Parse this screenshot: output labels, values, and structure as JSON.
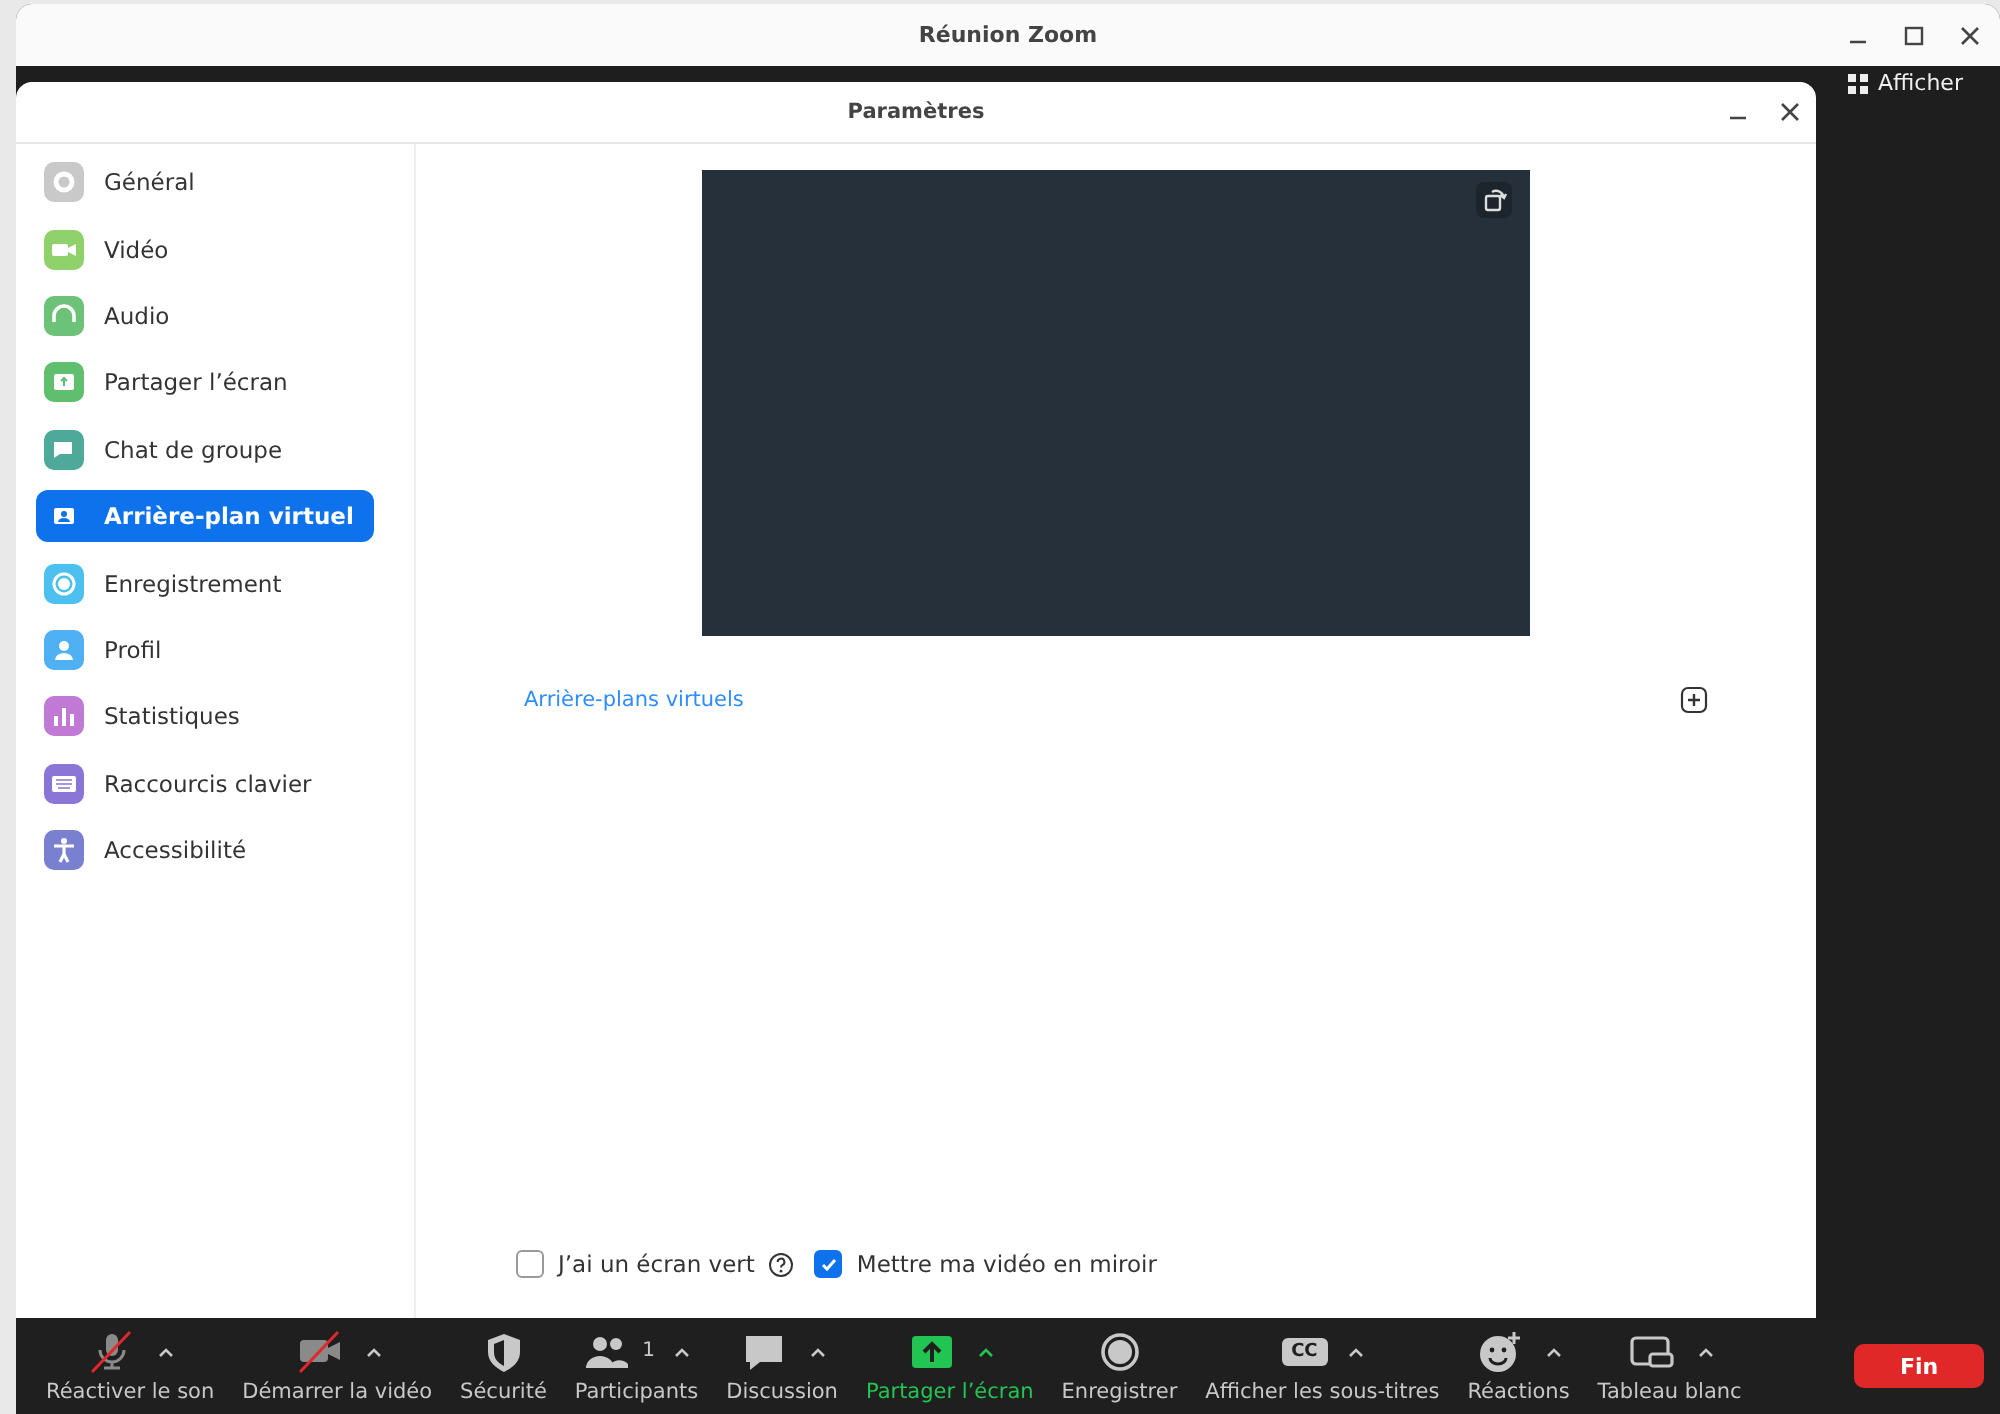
{
  "window": {
    "title": "Réunion Zoom"
  },
  "side_panel": {
    "button": "Afficher"
  },
  "dialog": {
    "title": "Paramètres"
  },
  "sidebar": {
    "items": [
      {
        "label": "Général",
        "color": "#c9c9c9",
        "selected": false
      },
      {
        "label": "Vidéo",
        "color": "#8fd16a",
        "selected": false
      },
      {
        "label": "Audio",
        "color": "#6cc276",
        "selected": false
      },
      {
        "label": "Partager l’écran",
        "color": "#5fbf6e",
        "selected": false
      },
      {
        "label": "Chat de groupe",
        "color": "#4fa99b",
        "selected": false
      },
      {
        "label": "Arrière-plan virtuel",
        "color": "#0e72ed",
        "selected": true
      },
      {
        "label": "Enregistrement",
        "color": "#4cc1f0",
        "selected": false
      },
      {
        "label": "Profil",
        "color": "#4fb0f2",
        "selected": false
      },
      {
        "label": "Statistiques",
        "color": "#c07ad6",
        "selected": false
      },
      {
        "label": "Raccourcis clavier",
        "color": "#8b76d8",
        "selected": false
      },
      {
        "label": "Accessibilité",
        "color": "#7a80d0",
        "selected": false
      }
    ]
  },
  "content": {
    "section_link": "Arrière-plans virtuels",
    "options": [
      {
        "label": "J’ai un écran vert",
        "checked": false,
        "help": true
      },
      {
        "label": "Mettre ma vidéo en miroir",
        "checked": true,
        "help": false
      }
    ]
  },
  "toolbar": {
    "items": [
      {
        "label": "Réactiver le son",
        "off": true,
        "active": false,
        "menu": true
      },
      {
        "label": "Démarrer la vidéo",
        "off": true,
        "active": false,
        "menu": true
      },
      {
        "label": "Sécurité",
        "off": false,
        "active": false,
        "menu": false
      },
      {
        "label": "Participants",
        "count": "1",
        "off": false,
        "active": false,
        "menu": true
      },
      {
        "label": "Discussion",
        "off": false,
        "active": false,
        "menu": true
      },
      {
        "label": "Partager l’écran",
        "off": false,
        "active": true,
        "menu": true
      },
      {
        "label": "Enregistrer",
        "off": false,
        "active": false,
        "menu": false
      },
      {
        "label": "Afficher les sous-titres",
        "icon_text": "CC",
        "off": false,
        "active": false,
        "menu": true
      },
      {
        "label": "Réactions",
        "off": false,
        "active": false,
        "menu": true
      },
      {
        "label": "Tableau blanc",
        "off": false,
        "active": false,
        "menu": true
      }
    ],
    "end_button": "Fin"
  }
}
